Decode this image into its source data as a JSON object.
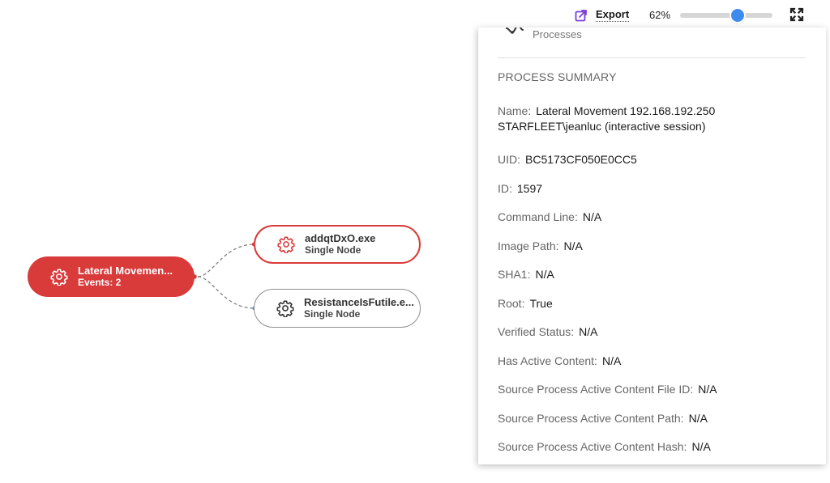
{
  "toolbar": {
    "export_label": "Export",
    "zoom_label": "62%",
    "zoom_value": 0.62,
    "icons": [
      "export-icon",
      "fullscreen-icon"
    ]
  },
  "colors": {
    "accent_red": "#d93a3a",
    "slider_blue": "#3d8bef",
    "export_icon_purple": "#7b3fd6"
  },
  "graph": {
    "root": {
      "title": "Lateral Movemen...",
      "subtitle": "Events: 2",
      "icon": "gear-icon"
    },
    "children": [
      {
        "title": "addqtDxO.exe",
        "subtitle": "Single Node",
        "icon": "gear-icon",
        "selected": true
      },
      {
        "title": "ResistanceIsFutile.e...",
        "subtitle": "Single Node",
        "icon": "gear-icon",
        "selected": false
      }
    ]
  },
  "panel": {
    "tab_label": "Processes",
    "tab_icon": "processes-icon",
    "summary_title": "PROCESS SUMMARY",
    "fields": [
      {
        "label": "Name:",
        "value": "Lateral Movement 192.168.192.250 STARFLEET\\jeanluc (interactive session)"
      },
      {
        "label": "UID:",
        "value": "BC5173CF050E0CC5"
      },
      {
        "label": "ID:",
        "value": "1597"
      },
      {
        "label": "Command Line:",
        "value": "N/A"
      },
      {
        "label": "Image Path:",
        "value": "N/A"
      },
      {
        "label": "SHA1:",
        "value": "N/A"
      },
      {
        "label": "Root:",
        "value": "True"
      },
      {
        "label": "Verified Status:",
        "value": "N/A"
      },
      {
        "label": "Has Active Content:",
        "value": "N/A"
      },
      {
        "label": "Source Process Active Content File ID:",
        "value": "N/A"
      },
      {
        "label": "Source Process Active Content Path:",
        "value": "N/A"
      },
      {
        "label": "Source Process Active Content Hash:",
        "value": "N/A"
      }
    ]
  }
}
